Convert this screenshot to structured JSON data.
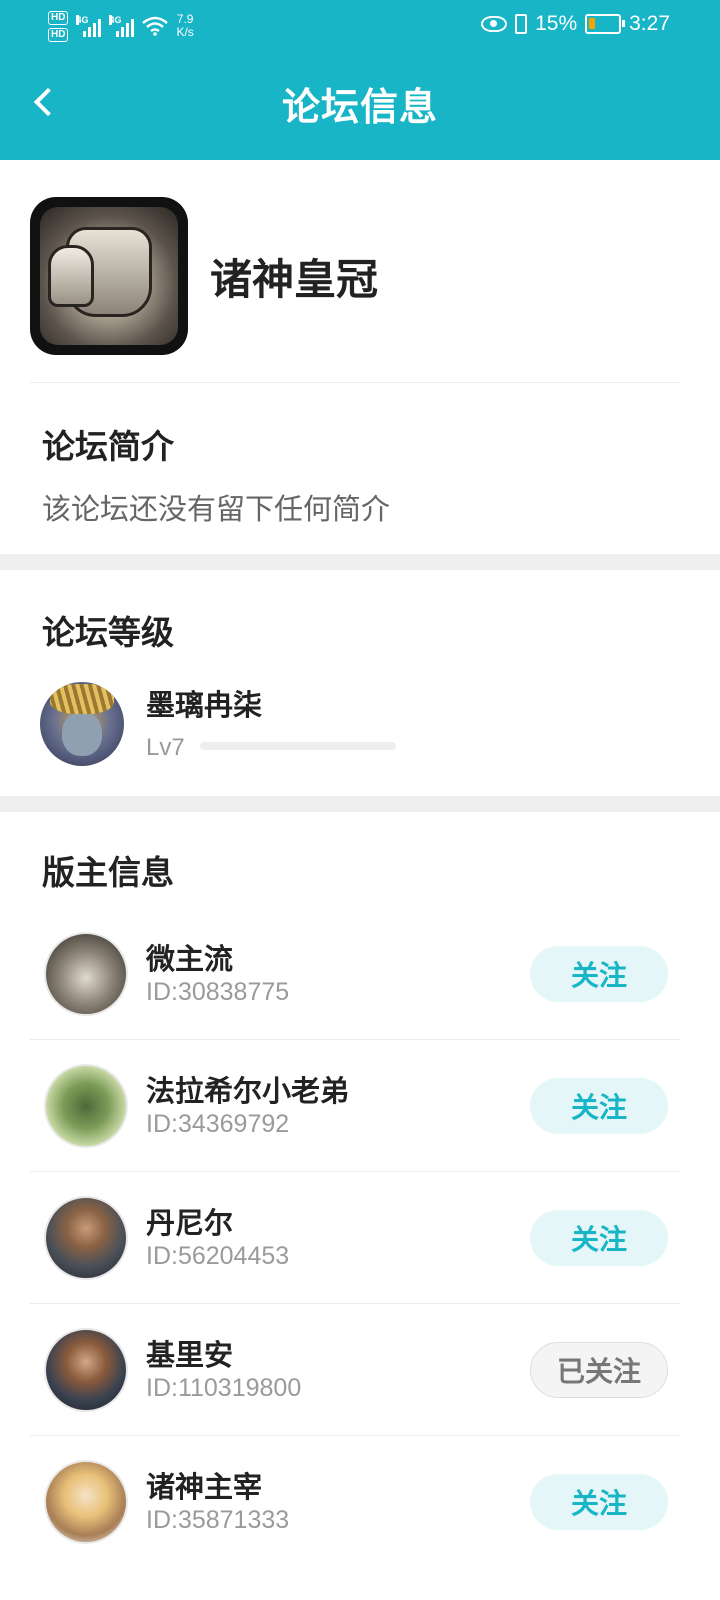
{
  "status_bar": {
    "hd1": "HD",
    "hd2": "HD",
    "net1": "4G",
    "net2": "4G",
    "speed_value": "7.9",
    "speed_unit": "K/s",
    "battery_percent": "15%",
    "time": "3:27"
  },
  "header": {
    "title": "论坛信息"
  },
  "forum": {
    "name": "诸神皇冠"
  },
  "intro": {
    "heading": "论坛简介",
    "text": "该论坛还没有留下任何简介"
  },
  "level": {
    "heading": "论坛等级",
    "name": "墨璃冉柒",
    "label": "Lv7",
    "progress": 0.0
  },
  "moderators": {
    "heading": "版主信息",
    "items": [
      {
        "name": "微主流",
        "id": "ID:30838775",
        "button": "关注",
        "followed": false
      },
      {
        "name": "法拉希尔小老弟",
        "id": "ID:34369792",
        "button": "关注",
        "followed": false
      },
      {
        "name": "丹尼尔",
        "id": "ID:56204453",
        "button": "关注",
        "followed": false
      },
      {
        "name": "基里安",
        "id": "ID:110319800",
        "button": "已关注",
        "followed": true
      },
      {
        "name": "诸神主宰",
        "id": "ID:35871333",
        "button": "关注",
        "followed": false
      }
    ]
  },
  "colors": {
    "accent": "#17b5c6",
    "follow_bg": "#e4f6f8",
    "followed_bg": "#f4f4f4"
  }
}
